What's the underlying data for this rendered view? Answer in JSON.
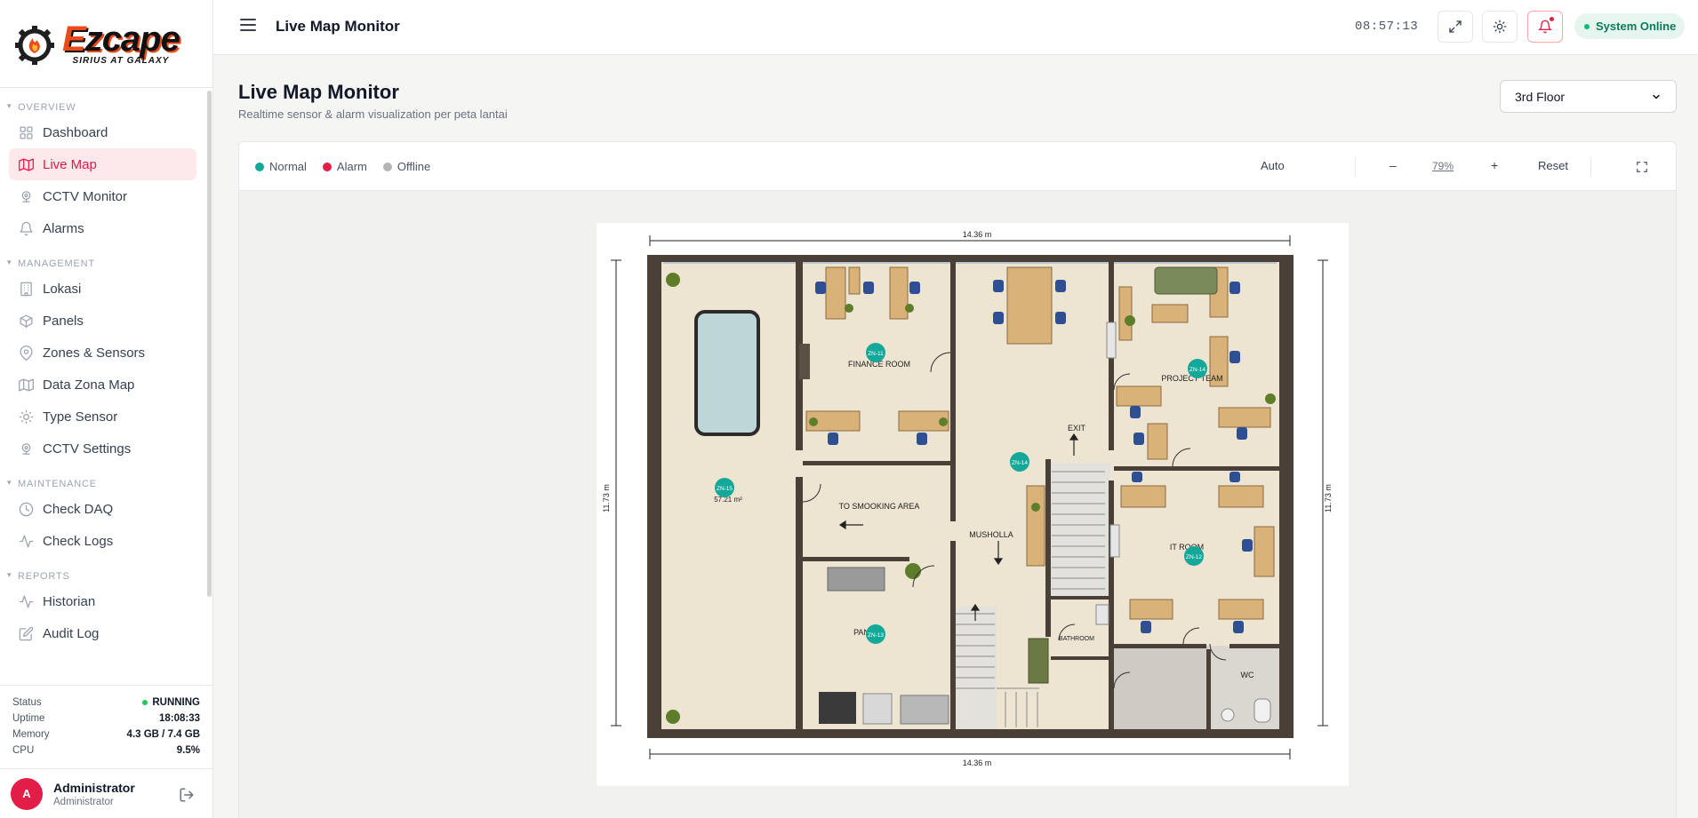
{
  "brand": {
    "logo_word": "Ezcape",
    "logo_sub": "SIRIUS AT GALAXY"
  },
  "sidebar": {
    "sections": [
      {
        "title": "OVERVIEW",
        "items": [
          {
            "label": "Dashboard",
            "icon": "grid-icon",
            "active": false
          },
          {
            "label": "Live Map",
            "icon": "map-icon",
            "active": true
          },
          {
            "label": "CCTV Monitor",
            "icon": "cctv-icon",
            "active": false
          },
          {
            "label": "Alarms",
            "icon": "bell-icon",
            "active": false
          }
        ]
      },
      {
        "title": "MANAGEMENT",
        "items": [
          {
            "label": "Lokasi",
            "icon": "building-icon",
            "active": false
          },
          {
            "label": "Panels",
            "icon": "package-icon",
            "active": false
          },
          {
            "label": "Zones & Sensors",
            "icon": "pin-icon",
            "active": false
          },
          {
            "label": "Data Zona Map",
            "icon": "map-icon",
            "active": false
          },
          {
            "label": "Type Sensor",
            "icon": "sun-icon",
            "active": false
          },
          {
            "label": "CCTV Settings",
            "icon": "cctv-icon",
            "active": false
          }
        ]
      },
      {
        "title": "MAINTENANCE",
        "items": [
          {
            "label": "Check DAQ",
            "icon": "clock-icon",
            "active": false
          },
          {
            "label": "Check Logs",
            "icon": "activity-icon",
            "active": false
          }
        ]
      },
      {
        "title": "REPORTS",
        "items": [
          {
            "label": "Historian",
            "icon": "activity-icon",
            "active": false
          },
          {
            "label": "Audit Log",
            "icon": "edit-icon",
            "active": false
          }
        ]
      }
    ],
    "system": {
      "status_label": "Status",
      "status_value": "RUNNING",
      "uptime_label": "Uptime",
      "uptime_value": "18:08:33",
      "memory_label": "Memory",
      "memory_value": "4.3 GB / 7.4 GB",
      "cpu_label": "CPU",
      "cpu_value": "9.5%"
    },
    "user": {
      "initial": "A",
      "name": "Administrator",
      "role": "Administrator"
    }
  },
  "topbar": {
    "title": "Live Map Monitor",
    "clock": "08:57:13",
    "status": "System Online"
  },
  "main": {
    "title": "Live Map Monitor",
    "subtitle": "Realtime sensor & alarm visualization per peta lantai",
    "floor_selected": "3rd Floor"
  },
  "toolbar": {
    "legend": [
      {
        "label": "Normal",
        "color": "#14a89b"
      },
      {
        "label": "Alarm",
        "color": "#e11d48"
      },
      {
        "label": "Offline",
        "color": "#b4b4b4"
      }
    ],
    "auto": "Auto",
    "minus": "–",
    "zoom": "79%",
    "plus": "+",
    "reset": "Reset"
  },
  "floorplan": {
    "dim_width": "14.36 m",
    "dim_height": "11.73 m",
    "rooms": {
      "finance": "FINANCE ROOM",
      "project": "PROJECT TEAM",
      "exit": "EXIT",
      "smoking": "TO SMOOKING AREA",
      "musholla": "MUSHOLLA",
      "it": "IT ROOM",
      "pantry": "PAN",
      "bathroom": "BATHROOM",
      "wc": "WC",
      "area": "57.21 m²"
    },
    "zones": [
      {
        "id": "ZN-11",
        "status": "normal"
      },
      {
        "id": "ZN-14",
        "status": "normal"
      },
      {
        "id": "ZN-15",
        "status": "normal"
      },
      {
        "id": "ZN-14",
        "status": "normal"
      },
      {
        "id": "ZN-12",
        "status": "normal"
      },
      {
        "id": "ZN-13",
        "status": "normal"
      }
    ]
  },
  "colors": {
    "accent": "#e11d48",
    "normal": "#14a89b",
    "online": "#10b981"
  }
}
